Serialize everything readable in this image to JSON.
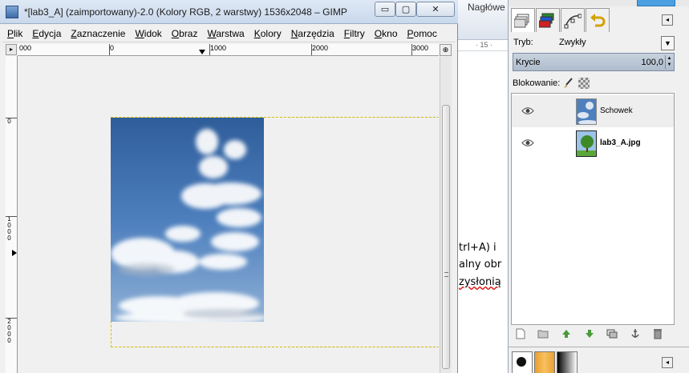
{
  "word": {
    "ribbon_label": "Nagłówe",
    "ruler_label": "· 15 ·",
    "lines": [
      {
        "pre": "trl+A) i",
        "err": ""
      },
      {
        "pre": "alny obr",
        "err": ""
      },
      {
        "pre": "",
        "err": "zysłonią"
      }
    ]
  },
  "gimp": {
    "title": "*[lab3_A] (zaimportowany)-2.0 (Kolory RGB, 2 warstwy) 1536x2048 – GIMP",
    "menu": [
      "Plik",
      "Edycja",
      "Zaznaczenie",
      "Widok",
      "Obraz",
      "Warstwa",
      "Kolory",
      "Narzędzia",
      "Filtry",
      "Okno",
      "Pomoc"
    ],
    "hruler_labels": [
      "000",
      "0",
      "1000",
      "2000",
      "3000"
    ],
    "vruler_labels": [
      "0",
      "1000",
      "2000"
    ],
    "window_buttons": {
      "minimize": "▭",
      "maximize": "▢",
      "close": "✕"
    }
  },
  "dock": {
    "mode_label": "Tryb:",
    "mode_value": "Zwykły",
    "opacity_label": "Krycie",
    "opacity_value": "100,0",
    "lock_label": "Blokowanie:",
    "layers": [
      {
        "name": "Schowek",
        "selected": true,
        "bold": false
      },
      {
        "name": "lab3_A.jpg",
        "selected": false,
        "bold": true
      }
    ],
    "icons": {
      "tabs": [
        "layers-icon",
        "channels-icon",
        "paths-icon",
        "undo-icon"
      ],
      "layer_buttons": [
        "new-layer-icon",
        "open-folder-icon",
        "raise-layer-icon",
        "lower-layer-icon",
        "duplicate-layer-icon",
        "anchor-icon",
        "delete-icon"
      ]
    }
  }
}
